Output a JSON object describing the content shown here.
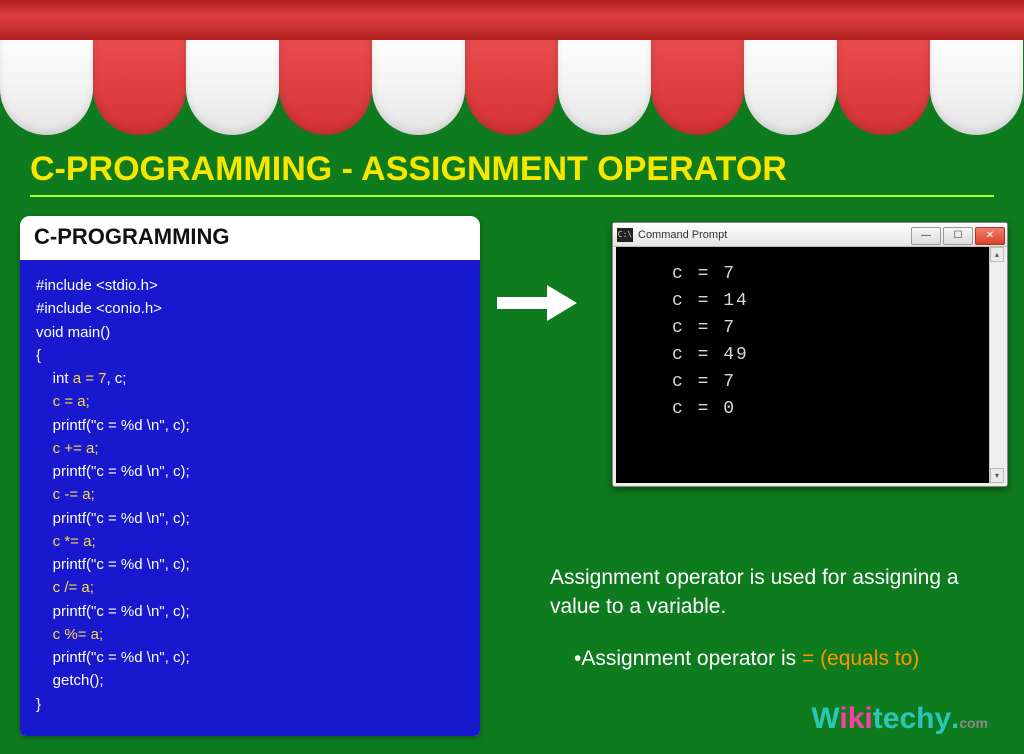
{
  "title": "C-PROGRAMMING - ASSIGNMENT OPERATOR",
  "code": {
    "header": "C-PROGRAMMING",
    "lines": [
      {
        "pre": "",
        "white": "#include <stdio.h>"
      },
      {
        "pre": "",
        "white": "#include <conio.h>"
      },
      {
        "pre": "",
        "white": "void main()"
      },
      {
        "pre": "",
        "white": "{"
      },
      {
        "pre": "    ",
        "white": "int ",
        "yellow": "a = 7",
        "white2": ", c;"
      },
      {
        "pre": "    ",
        "yellow": "c = a;"
      },
      {
        "pre": "    ",
        "white": "printf(\"c = %d \\n\", c);"
      },
      {
        "pre": "    ",
        "yellow": "c += a;"
      },
      {
        "pre": "    ",
        "white": "printf(\"c = %d \\n\", c);"
      },
      {
        "pre": "    ",
        "yellow": "c -= a;"
      },
      {
        "pre": "    ",
        "white": "printf(\"c = %d \\n\", c);"
      },
      {
        "pre": "    ",
        "yellow": "c *= a;"
      },
      {
        "pre": "    ",
        "white": "printf(\"c = %d \\n\", c);"
      },
      {
        "pre": "    ",
        "yellow": "c /= a;"
      },
      {
        "pre": "    ",
        "white": "printf(\"c = %d \\n\", c);"
      },
      {
        "pre": "    ",
        "yellow": "c %= a;"
      },
      {
        "pre": "    ",
        "white": "printf(\"c = %d \\n\", c);"
      },
      {
        "pre": "    ",
        "white": "getch();"
      },
      {
        "pre": "",
        "white": "}"
      }
    ]
  },
  "cmd": {
    "title": "Command Prompt",
    "icon_label": "C:\\",
    "output": [
      "c = 7",
      "c = 14",
      "c = 7",
      "c = 49",
      "c = 7",
      "c = 0"
    ]
  },
  "desc": {
    "line1": "Assignment operator is used for assigning a value to a variable.",
    "bullet_pre": "•Assignment operator is ",
    "bullet_highlight": "= (equals to)"
  },
  "logo": {
    "w": "W",
    "iki": "iki",
    "techy": "techy",
    "dot": ".",
    "com": "com"
  }
}
